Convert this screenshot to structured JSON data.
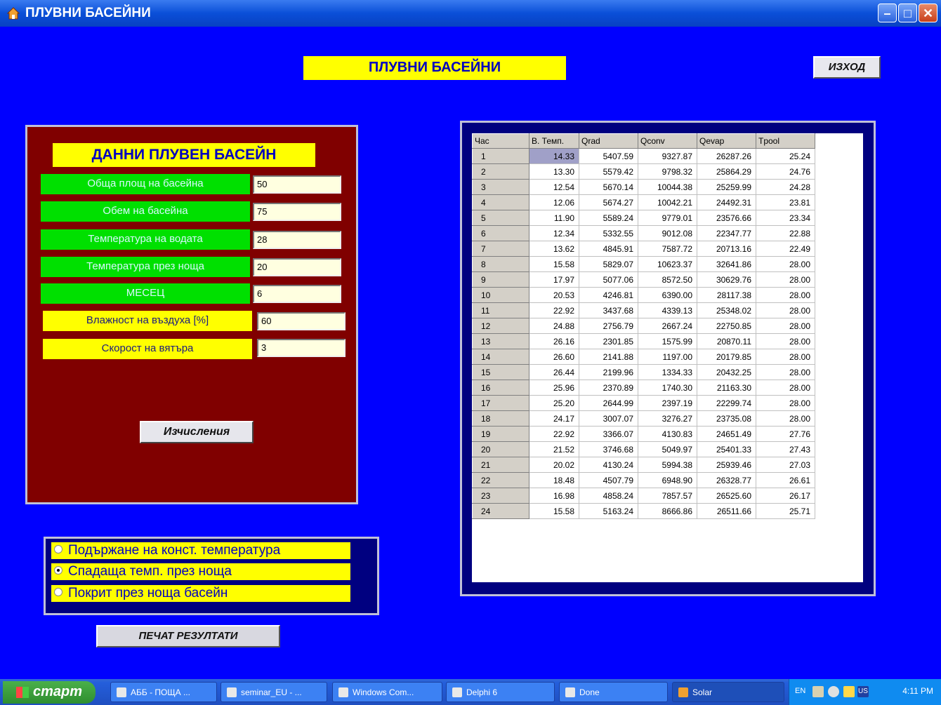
{
  "window": {
    "title": "ПЛУВНИ БАСЕЙНИ",
    "controls": {
      "minimize": "–",
      "maximize": "□",
      "close": "✕"
    }
  },
  "header": {
    "banner": "ПЛУВНИ БАСЕЙНИ",
    "exit_label": "ИЗХОД"
  },
  "input_panel": {
    "title": "ДАННИ  ПЛУВЕН БАСЕЙН",
    "fields": [
      {
        "label": "Обща площ на басейна",
        "value": "50"
      },
      {
        "label": "Обем на басейна",
        "value": "75"
      },
      {
        "label": "Температура на водата",
        "value": "28"
      },
      {
        "label": "Температура през ноща",
        "value": "20"
      },
      {
        "label": "МЕСЕЦ",
        "value": "6"
      },
      {
        "label": "Влажност на въздуха [%]",
        "value": "60"
      },
      {
        "label": "Скорост на вятъра",
        "value": "3"
      }
    ],
    "calc_label": "Изчисления"
  },
  "modes": {
    "options": [
      {
        "label": "Подържане на конст. температура",
        "selected": false
      },
      {
        "label": "Спадаща темп. през нощa",
        "selected": true
      },
      {
        "label": "Покрит през нощa басейн",
        "selected": false
      }
    ]
  },
  "print_label": "ПЕЧАТ РЕЗУЛТАТИ",
  "results": {
    "columns": [
      "Час",
      "В. Темп.",
      "Qrad",
      "Qconv",
      "Qevap",
      "Tpool"
    ],
    "rows": [
      [
        "1",
        "14.33",
        "5407.59",
        "9327.87",
        "26287.26",
        "25.24"
      ],
      [
        "2",
        "13.30",
        "5579.42",
        "9798.32",
        "25864.29",
        "24.76"
      ],
      [
        "3",
        "12.54",
        "5670.14",
        "10044.38",
        "25259.99",
        "24.28"
      ],
      [
        "4",
        "12.06",
        "5674.27",
        "10042.21",
        "24492.31",
        "23.81"
      ],
      [
        "5",
        "11.90",
        "5589.24",
        "9779.01",
        "23576.66",
        "23.34"
      ],
      [
        "6",
        "12.34",
        "5332.55",
        "9012.08",
        "22347.77",
        "22.88"
      ],
      [
        "7",
        "13.62",
        "4845.91",
        "7587.72",
        "20713.16",
        "22.49"
      ],
      [
        "8",
        "15.58",
        "5829.07",
        "10623.37",
        "32641.86",
        "28.00"
      ],
      [
        "9",
        "17.97",
        "5077.06",
        "8572.50",
        "30629.76",
        "28.00"
      ],
      [
        "10",
        "20.53",
        "4246.81",
        "6390.00",
        "28117.38",
        "28.00"
      ],
      [
        "11",
        "22.92",
        "3437.68",
        "4339.13",
        "25348.02",
        "28.00"
      ],
      [
        "12",
        "24.88",
        "2756.79",
        "2667.24",
        "22750.85",
        "28.00"
      ],
      [
        "13",
        "26.16",
        "2301.85",
        "1575.99",
        "20870.11",
        "28.00"
      ],
      [
        "14",
        "26.60",
        "2141.88",
        "1197.00",
        "20179.85",
        "28.00"
      ],
      [
        "15",
        "26.44",
        "2199.96",
        "1334.33",
        "20432.25",
        "28.00"
      ],
      [
        "16",
        "25.96",
        "2370.89",
        "1740.30",
        "21163.30",
        "28.00"
      ],
      [
        "17",
        "25.20",
        "2644.99",
        "2397.19",
        "22299.74",
        "28.00"
      ],
      [
        "18",
        "24.17",
        "3007.07",
        "3276.27",
        "23735.08",
        "28.00"
      ],
      [
        "19",
        "22.92",
        "3366.07",
        "4130.83",
        "24651.49",
        "27.76"
      ],
      [
        "20",
        "21.52",
        "3746.68",
        "5049.97",
        "25401.33",
        "27.43"
      ],
      [
        "21",
        "20.02",
        "4130.24",
        "5994.38",
        "25939.46",
        "27.03"
      ],
      [
        "22",
        "18.48",
        "4507.79",
        "6948.90",
        "26328.77",
        "26.61"
      ],
      [
        "23",
        "16.98",
        "4858.24",
        "7857.57",
        "26525.60",
        "26.17"
      ],
      [
        "24",
        "15.58",
        "5163.24",
        "8666.86",
        "26511.66",
        "25.71"
      ]
    ]
  },
  "taskbar": {
    "start_label": "старт",
    "tasks": [
      "АББ - ПОЩА ...",
      "seminar_EU - ...",
      "Windows Com...",
      "Delphi 6",
      "Done",
      "Solar"
    ],
    "lang": "EN",
    "locale": "US",
    "clock": "4:11 PM"
  },
  "colors": {
    "background": "#0000ff",
    "panel": "#800000",
    "banner": "#ffff00",
    "field_label_green": "#00e000"
  }
}
